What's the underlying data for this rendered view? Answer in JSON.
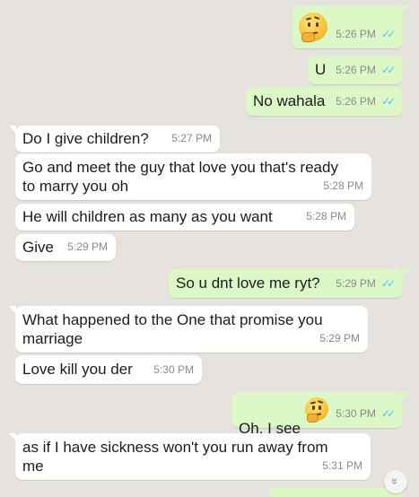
{
  "messages": [
    {
      "dir": "out",
      "text": "",
      "emoji": "thinking-face",
      "time": "5:26 PM"
    },
    {
      "dir": "out",
      "text": "U",
      "time": "5:26 PM"
    },
    {
      "dir": "out",
      "text": "No wahala",
      "time": "5:26 PM"
    },
    {
      "dir": "in",
      "text": "Do I give children?",
      "time": "5:27 PM"
    },
    {
      "dir": "in",
      "text": "Go and meet the guy that love you that's ready\nto marry you oh",
      "time": "5:28 PM"
    },
    {
      "dir": "in",
      "text": "He will children as many as you want",
      "time": "5:28 PM"
    },
    {
      "dir": "in",
      "text": "Give",
      "time": "5:29 PM"
    },
    {
      "dir": "out",
      "text": "So u dnt love me ryt?",
      "time": "5:29 PM"
    },
    {
      "dir": "in",
      "text": "What happened to the One that promise you\nmarriage",
      "time": "5:29 PM"
    },
    {
      "dir": "in",
      "text": "Love kill you der",
      "time": "5:30 PM"
    },
    {
      "dir": "out",
      "text": "Oh,  I see",
      "emoji": "thinking-face",
      "time": "5:30 PM"
    },
    {
      "dir": "in",
      "text": "as if I have sickness won't you run away from\nme",
      "time": "5:31 PM"
    }
  ],
  "read_ticks": "✓✓",
  "scroll_down_icon": "chevron-double-down",
  "scroll_down_glyph": "»",
  "colors": {
    "incoming": "#ffffff",
    "outgoing": "#dcf8c6",
    "ticks": "#4fc3f7",
    "background": "#e6e3de"
  }
}
